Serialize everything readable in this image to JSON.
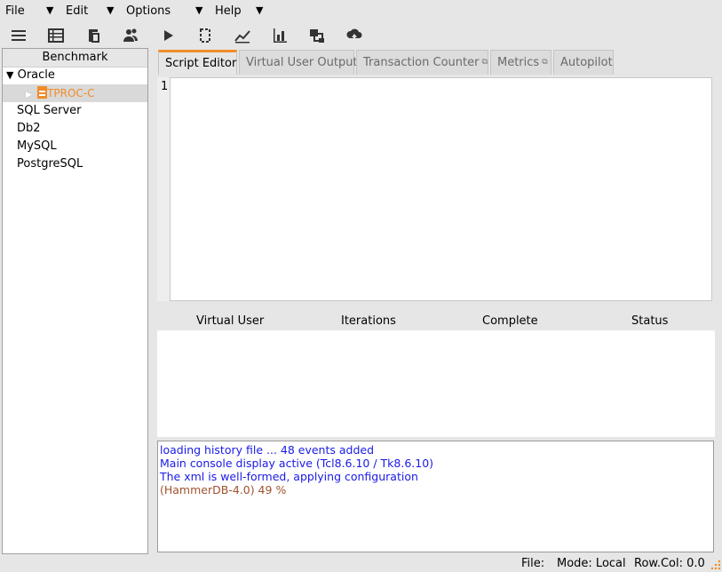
{
  "menu": {
    "file": "File",
    "edit": "Edit",
    "options": "Options",
    "help": "Help"
  },
  "toolbar": {
    "icons": [
      "menu-icon",
      "benchmark-table-icon",
      "script-icon",
      "virtual-users-icon",
      "run-icon",
      "tcount-icon",
      "metrics-icon",
      "chart-icon",
      "transactions-icon",
      "cloud-icon"
    ]
  },
  "tree": {
    "header": "Benchmark",
    "oracle": "Oracle",
    "tproc": "TPROC-C",
    "sqlserver": "SQL Server",
    "db2": "Db2",
    "mysql": "MySQL",
    "postgres": "PostgreSQL"
  },
  "tabs": {
    "script_editor": "Script Editor",
    "vu_output": "Virtual User Output",
    "tx_counter": "Transaction Counter",
    "metrics": "Metrics",
    "autopilot": "Autopilot"
  },
  "editor": {
    "line_number": "1"
  },
  "vu_table": {
    "columns": [
      "Virtual User",
      "Iterations",
      "Complete",
      "Status"
    ]
  },
  "console": {
    "line1": "loading history file ... 48 events added",
    "line2": "Main console display active (Tcl8.6.10 / Tk8.6.10)",
    "line3": "The xml is well-formed, applying configuration",
    "line4": "(HammerDB-4.0) 49 %"
  },
  "status": {
    "file": "File:",
    "mode": "Mode: Local",
    "rowcol": "Row.Col:  0.0"
  },
  "colors": {
    "accent": "#f08c2a",
    "console_blue": "#1a1ae6",
    "console_brown": "#a0522d"
  }
}
